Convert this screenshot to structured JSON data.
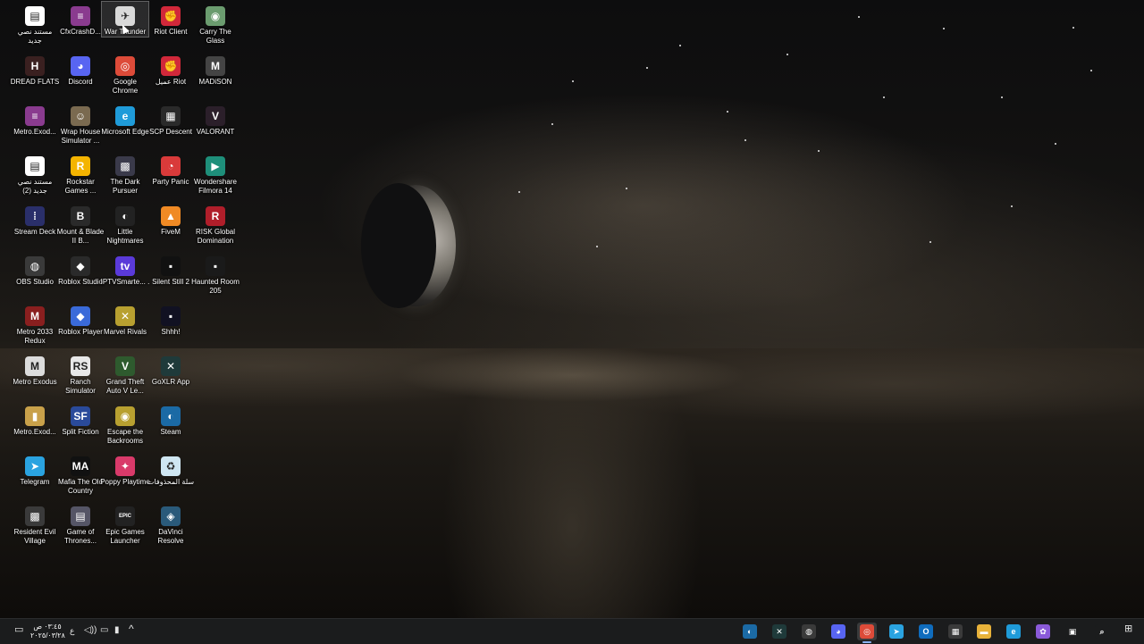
{
  "desktop": {
    "icons": [
      {
        "label": "مستند نصي جديد",
        "icon": "text-document-icon",
        "color": "#ffffff",
        "glyph": "▤",
        "col": 0,
        "row": 0
      },
      {
        "label": "CfxCrashD...",
        "icon": "winrar-archive-icon",
        "color": "#8a3b8f",
        "glyph": "≡",
        "col": 1,
        "row": 0
      },
      {
        "label": "War Thunder",
        "icon": "war-thunder-icon",
        "color": "#d9d9d9",
        "glyph": "✈",
        "col": 2,
        "row": 0,
        "selected": true
      },
      {
        "label": "Riot Client",
        "icon": "riot-client-icon",
        "color": "#d1283a",
        "glyph": "✊",
        "col": 3,
        "row": 0
      },
      {
        "label": "Carry The Glass",
        "icon": "carry-the-glass-icon",
        "color": "#6b9c6f",
        "glyph": "◉",
        "col": 4,
        "row": 0
      },
      {
        "label": "DREAD FLATS",
        "icon": "dread-flats-icon",
        "color": "#3a2020",
        "glyph": "H",
        "col": 0,
        "row": 1
      },
      {
        "label": "Discord",
        "icon": "discord-icon",
        "color": "#5865f2",
        "glyph": "◕",
        "col": 1,
        "row": 1
      },
      {
        "label": "Google Chrome",
        "icon": "chrome-icon",
        "color": "#dd4b39",
        "glyph": "◎",
        "col": 2,
        "row": 1
      },
      {
        "label": "عميل Riot",
        "icon": "riot-client-icon",
        "color": "#d1283a",
        "glyph": "✊",
        "col": 3,
        "row": 1
      },
      {
        "label": "MADiSON",
        "icon": "madison-icon",
        "color": "#444444",
        "glyph": "M",
        "col": 4,
        "row": 1
      },
      {
        "label": "Metro.Exod...",
        "icon": "winrar-archive-icon",
        "color": "#8a3b8f",
        "glyph": "≡",
        "col": 0,
        "row": 2
      },
      {
        "label": "Wrap House Simulator ...",
        "icon": "wrap-house-icon",
        "color": "#7a6a50",
        "glyph": "☺",
        "col": 1,
        "row": 2
      },
      {
        "label": "Microsoft Edge",
        "icon": "edge-icon",
        "color": "#1f9bd9",
        "glyph": "e",
        "col": 2,
        "row": 2
      },
      {
        "label": "SCP Descent",
        "icon": "scp-descent-icon",
        "color": "#2a2a2a",
        "glyph": "▦",
        "col": 3,
        "row": 2
      },
      {
        "label": "VALORANT",
        "icon": "valorant-icon",
        "color": "#2b1f2a",
        "glyph": "V",
        "col": 4,
        "row": 2
      },
      {
        "label": "مستند نصي جديد (2)",
        "icon": "text-document-icon",
        "color": "#ffffff",
        "glyph": "▤",
        "col": 0,
        "row": 3
      },
      {
        "label": "Rockstar Games ...",
        "icon": "rockstar-icon",
        "color": "#f4b400",
        "glyph": "R",
        "col": 1,
        "row": 3
      },
      {
        "label": "The Dark Pursuer",
        "icon": "dark-pursuer-icon",
        "color": "#3a3a4a",
        "glyph": "▩",
        "col": 2,
        "row": 3
      },
      {
        "label": "Party Panic",
        "icon": "party-panic-icon",
        "color": "#d93a3a",
        "glyph": "◔",
        "col": 3,
        "row": 3
      },
      {
        "label": "Wondershare Filmora 14",
        "icon": "filmora-icon",
        "color": "#1e8f7a",
        "glyph": "▶",
        "col": 4,
        "row": 3
      },
      {
        "label": "Stream Deck",
        "icon": "stream-deck-icon",
        "color": "#2a2f6a",
        "glyph": "⁞",
        "col": 0,
        "row": 4
      },
      {
        "label": "Mount & Blade II B...",
        "icon": "mount-blade-icon",
        "color": "#2a2a2a",
        "glyph": "B",
        "col": 1,
        "row": 4
      },
      {
        "label": "Little Nightmares",
        "icon": "little-nightmares-icon",
        "color": "#222222",
        "glyph": "◐",
        "col": 2,
        "row": 4
      },
      {
        "label": "FiveM",
        "icon": "fivem-icon",
        "color": "#f08a24",
        "glyph": "▲",
        "col": 3,
        "row": 4
      },
      {
        "label": "RISK Global Domination",
        "icon": "risk-icon",
        "color": "#b01e2a",
        "glyph": "R",
        "col": 4,
        "row": 4
      },
      {
        "label": "OBS Studio",
        "icon": "obs-icon",
        "color": "#3a3a3a",
        "glyph": "◍",
        "col": 0,
        "row": 5
      },
      {
        "label": "Roblox Studio",
        "icon": "roblox-studio-icon",
        "color": "#2a2a2a",
        "glyph": "◆",
        "col": 1,
        "row": 5
      },
      {
        "label": "IPTVSmarte... .",
        "icon": "iptv-icon",
        "color": "#5a3ad9",
        "glyph": "tv",
        "col": 2,
        "row": 5
      },
      {
        "label": "Silent Still 2",
        "icon": "silent-still-icon",
        "color": "#111111",
        "glyph": "▪",
        "col": 3,
        "row": 5
      },
      {
        "label": "Haunted Room 205",
        "icon": "haunted-room-icon",
        "color": "#1a1a1a",
        "glyph": "▪",
        "col": 4,
        "row": 5
      },
      {
        "label": "Metro 2033 Redux",
        "icon": "metro-2033-icon",
        "color": "#8a1f1f",
        "glyph": "M",
        "col": 0,
        "row": 6
      },
      {
        "label": "Roblox Player",
        "icon": "roblox-player-icon",
        "color": "#3a6ad9",
        "glyph": "◆",
        "col": 1,
        "row": 6
      },
      {
        "label": "Marvel Rivals",
        "icon": "marvel-rivals-icon",
        "color": "#b8a030",
        "glyph": "✕",
        "col": 2,
        "row": 6
      },
      {
        "label": "Shhh!",
        "icon": "shhh-icon",
        "color": "#111122",
        "glyph": "▪",
        "col": 3,
        "row": 6
      },
      {
        "label": "Metro Exodus",
        "icon": "metro-exodus-icon",
        "color": "#dcdcdc",
        "glyph": "M",
        "col": 0,
        "row": 7
      },
      {
        "label": "Ranch Simulator",
        "icon": "ranch-simulator-icon",
        "color": "#e8e8e8",
        "glyph": "RS",
        "col": 1,
        "row": 7
      },
      {
        "label": "Grand Theft Auto V Le...",
        "icon": "gta-v-icon",
        "color": "#2e5a2e",
        "glyph": "V",
        "col": 2,
        "row": 7
      },
      {
        "label": "GoXLR App",
        "icon": "goxlr-icon",
        "color": "#1f3a3a",
        "glyph": "✕",
        "col": 3,
        "row": 7
      },
      {
        "label": "Metro.Exod...",
        "icon": "archive-icon",
        "color": "#c9a14a",
        "glyph": "▮",
        "col": 0,
        "row": 8
      },
      {
        "label": "Split Fiction",
        "icon": "split-fiction-icon",
        "color": "#2a4a9a",
        "glyph": "SF",
        "col": 1,
        "row": 8
      },
      {
        "label": "Escape the Backrooms",
        "icon": "escape-backrooms-icon",
        "color": "#b8a030",
        "glyph": "◉",
        "col": 2,
        "row": 8
      },
      {
        "label": "Steam",
        "icon": "steam-icon",
        "color": "#1b6aa5",
        "glyph": "◐",
        "col": 3,
        "row": 8
      },
      {
        "label": "Telegram",
        "icon": "telegram-icon",
        "color": "#2aa3e0",
        "glyph": "➤",
        "col": 0,
        "row": 9
      },
      {
        "label": "Mafia The Old Country",
        "icon": "mafia-icon",
        "color": "#111111",
        "glyph": "MA",
        "col": 1,
        "row": 9
      },
      {
        "label": "Poppy Playtime",
        "icon": "poppy-playtime-icon",
        "color": "#d93a6a",
        "glyph": "✦",
        "col": 2,
        "row": 9
      },
      {
        "label": "سلة المحذوفات",
        "icon": "recycle-bin-icon",
        "color": "#cfe6f2",
        "glyph": "♻",
        "col": 3,
        "row": 9
      },
      {
        "label": "Resident Evil Village",
        "icon": "resident-evil-icon",
        "color": "#3a3a3a",
        "glyph": "▩",
        "col": 0,
        "row": 10
      },
      {
        "label": "Game of Thrones...",
        "icon": "game-of-thrones-icon",
        "color": "#555566",
        "glyph": "▤",
        "col": 1,
        "row": 10
      },
      {
        "label": "Epic Games Launcher",
        "icon": "epic-games-icon",
        "color": "#222222",
        "glyph": "EPIC",
        "col": 2,
        "row": 10
      },
      {
        "label": "DaVinci Resolve",
        "icon": "davinci-resolve-icon",
        "color": "#2a5a7a",
        "glyph": "◈",
        "col": 3,
        "row": 10
      }
    ]
  },
  "taskbar": {
    "left": {
      "time": "٠٣:٤٥ ص",
      "date": "٢٠٢٥/٠٣/٢٨",
      "language": "ع"
    },
    "apps": [
      {
        "icon": "steam-icon",
        "color": "#1b6aa5",
        "glyph": "◐"
      },
      {
        "icon": "goxlr-icon",
        "color": "#1f3a3a",
        "glyph": "✕"
      },
      {
        "icon": "obs-icon",
        "color": "#3a3a3a",
        "glyph": "◍"
      },
      {
        "icon": "discord-icon",
        "color": "#5865f2",
        "glyph": "◕"
      },
      {
        "icon": "chrome-icon",
        "color": "#dd4b39",
        "glyph": "◎",
        "active": true
      },
      {
        "icon": "telegram-icon",
        "color": "#2aa3e0",
        "glyph": "➤"
      },
      {
        "icon": "outlook-icon",
        "color": "#0f6cbd",
        "glyph": "O"
      },
      {
        "icon": "store-icon",
        "color": "#3a3a3a",
        "glyph": "▦"
      },
      {
        "icon": "file-explorer-icon",
        "color": "#e8b23a",
        "glyph": "▬"
      },
      {
        "icon": "edge-icon",
        "color": "#1f9bd9",
        "glyph": "e"
      },
      {
        "icon": "copilot-icon",
        "color": "#8a5ad9",
        "glyph": "✿"
      },
      {
        "icon": "task-view-icon",
        "color": "#1b1c1d",
        "glyph": "▣"
      },
      {
        "icon": "search-icon",
        "color": "#1b1c1d",
        "glyph": "⌕"
      }
    ]
  }
}
